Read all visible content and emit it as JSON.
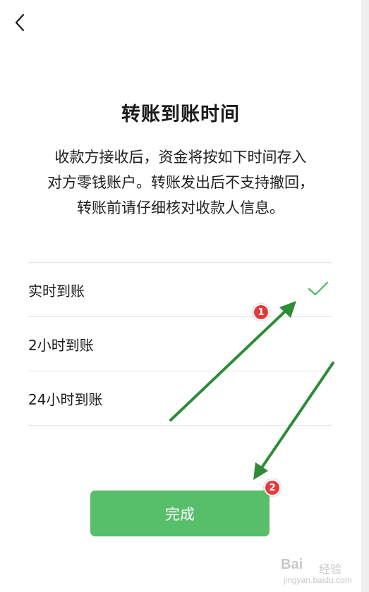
{
  "header": {
    "back_icon": "chevron-left-icon"
  },
  "page": {
    "title": "转账到账时间",
    "description_lines": [
      "收款方接收后，资金将按如下时间存入",
      "对方零钱账户。转账发出后不支持撤回，",
      "转账前请仔细核对收款人信息。"
    ]
  },
  "options": [
    {
      "label": "实时到账",
      "selected": true
    },
    {
      "label": "2小时到账",
      "selected": false
    },
    {
      "label": "24小时到账",
      "selected": false
    }
  ],
  "done_button": {
    "label": "完成"
  },
  "annotations": {
    "badge_1": "1",
    "badge_2": "2"
  },
  "watermark": {
    "brand": "Bai",
    "sub": "经验",
    "url": "jingyan.baidu.com"
  },
  "colors": {
    "accent_green": "#57be6a",
    "check_green": "#4fb864",
    "arrow_green": "#2e8b37",
    "badge_red": "#e33b3b"
  }
}
